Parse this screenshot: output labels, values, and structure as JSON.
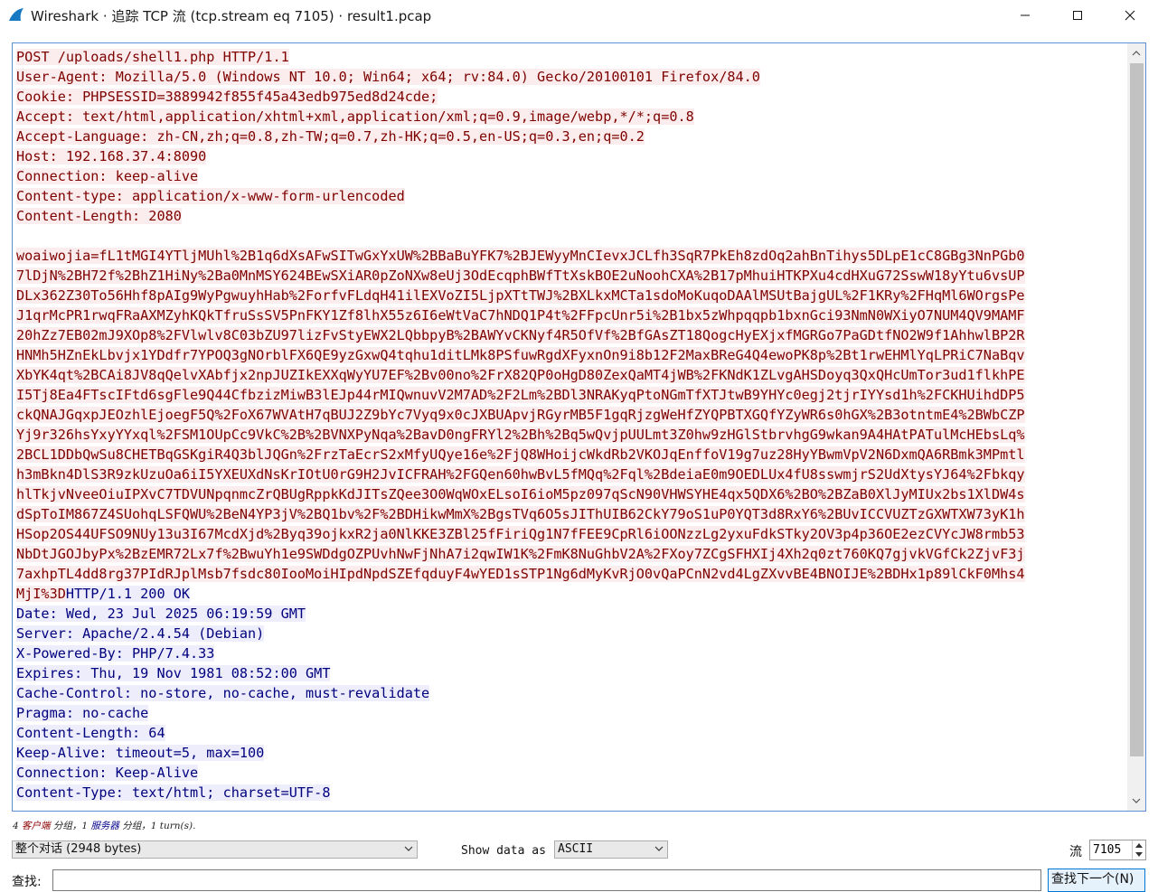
{
  "window": {
    "title": "Wireshark · 追踪 TCP 流 (tcp.stream eq 7105) · result1.pcap"
  },
  "stream": {
    "client_header_lines": [
      "POST /uploads/shell1.php HTTP/1.1",
      "User-Agent: Mozilla/5.0 (Windows NT 10.0; Win64; x64; rv:84.0) Gecko/20100101 Firefox/84.0",
      "Cookie: PHPSESSID=3889942f855f45a43edb975ed8d24cde;",
      "Accept: text/html,application/xhtml+xml,application/xml;q=0.9,image/webp,*/*;q=0.8",
      "Accept-Language: zh-CN,zh;q=0.8,zh-TW;q=0.7,zh-HK;q=0.5,en-US;q=0.3,en;q=0.2",
      "Host: 192.168.37.4:8090",
      "Connection: keep-alive",
      "Content-type: application/x-www-form-urlencoded",
      "Content-Length: 2080"
    ],
    "client_body_lines": [
      "woaiwojia=fL1tMGI4YTljMUhl%2B1q6dXsAFwSITwGxYxUW%2BBaBuYFK7%2BJEWyyMnCIevxJCLfh3SqR7PkEh8zdOq2ahBnTihys5DLpE1cC8GBg3NnPGb0",
      "7lDjN%2BH72f%2BhZ1HiNy%2Ba0MnMSY624BEwSXiAR0pZoNXw8eUj3OdEcqphBWfTtXskBOE2uNoohCXA%2B17pMhuiHTKPXu4cdHXuG72SswW18yYtu6vsUP",
      "DLx362Z30To56Hhf8pAIg9WyPgwuyhHab%2ForfvFLdqH41ilEXVoZI5LjpXTtTWJ%2BXLkxMCTa1sdoMoKuqoDAAlMSUtBajgUL%2F1KRy%2FHqMl6WOrgsPe",
      "J1qrMcPR1rwqFRaAXMZyhKQkTfruSsSV5PnFKY1Zf8lhX55z6I6eWtVaC7hNDQ1P4t%2FFpcUnr5i%2B1bx5zWhpqqpb1bxnGci93NmN0WXiyO7NUM4QV9MAMF",
      "20hZz7EB02mJ9XOp8%2FVlwlv8C03bZU97lizFvStyEWX2LQbbpyB%2BAWYvCKNyf4R5OfVf%2BfGAsZT18QogcHyEXjxfMGRGo7PaGDtfNO2W9f1AhhwlBP2R",
      "HNMh5HZnEkLbvjx1YDdfr7YPOQ3gNOrblFX6QE9yzGxwQ4tqhu1ditLMk8PSfuwRgdXFyxnOn9i8b12F2MaxBReG4Q4ewoPK8p%2Bt1rwEHMlYqLPRiC7NaBqv",
      "XbYK4qt%2BCAi8JV8qQelvXAbfjx2npJUZIkEXXqWyYU7EF%2Bv00no%2FrX82QP0oHgD80ZexQaMT4jWB%2FKNdK1ZLvgAHSDoyq3QxQHcUmTor3ud1flkhPE",
      "I5Tj8Ea4FTscIFtd6sgFle9Q44CfbzizMiwB3lEJp44rMIQwnuvV2M7AD%2F2Lm%2BDl3NRAKyqPtoNGmTfXTJtwB9YHYc0egj2tjrIYYsd1h%2FCKHUihdDP5",
      "ckQNAJGqxpJEOzhlEjoegF5Q%2FoX67WVAtH7qBUJ2Z9bYc7Vyq9x0cJXBUApvjRGyrMB5F1gqRjzgWeHfZYQPBTXGQfYZyWR6s0hGX%2B3otntmE4%2BWbCZP",
      "Yj9r326hsYxyYYxql%2FSM1OUpCc9VkC%2B%2BVNXPyNqa%2BavD0ngFRYl2%2Bh%2Bq5wQvjpUULmt3Z0hw9zHGlStbrvhgG9wkan9A4HAtPATulMcHEbsLq%",
      "2BCL1DDbQwSu8CHETBqGSKgiR4Q3blJQGn%2FrzTaEcrS2xMfyUQye16e%2FjQ8WHoijcWkdRb2VKOJqEnffoV19g7uz28HyYBwmVpV2N6DxmQA6RBmk3MPmtl",
      "h3mBkn4DlS3R9zkUzuOa6iI5YXEUXdNsKrIOtU0rG9H2JvICFRAH%2FGQen60hwBvL5fMQq%2Fql%2BdeiaE0m9OEDLUx4fU8sswmjrS2UdXtysYJ64%2Fbkqy",
      "hlTkjvNveeOiuIPXvC7TDVUNpqnmcZrQBUgRppkKdJITsZQee3O0WqWOxELsoI6ioM5pz097qScN90VHWSYHE4qx5QDX6%2BO%2BZaB0XlJyMIUx2bs1XlDW4s",
      "dSpToIM867Z4SUohqLSFQWU%2BeN4YP3jV%2BQ1bv%2F%2BDHikwMmX%2BgsTVq6O5sJIThUIB62CkY79oS1uP0YQT3d8RxY6%2BUvICCVUZTzGXWTXW73yK1h",
      "HSop2OS44UFSO9NUy13u3I67McdXjd%2Byq39ojkxR2ja0NlKKE3ZBl25fFiriQg1N7fFEE9CpRl6iOONzzLg2yxuFdkSTky2OV3p4p36OE2ezCVYcJW8rmb53",
      "NbDtJGOJbyPx%2BzEMR72Lx7f%2BwuYh1e9SWDdgOZPUvhNwFjNhA7i2qwIW1K%2FmK8NuGhbV2A%2FXoy7ZCgSFHXIj4Xh2q0zt760KQ7gjvkVGfCk2ZjvF3j",
      "7axhpTL4dd8rg37PIdRJplMsb7fsdc80IooMoiHIpdNpdSZEfqduyF4wYED1sSTP1Ng6dMyKvRjO0vQaPCnN2vd4LgZXvvBE4BNOIJE%2BDHx1p89lCkF0Mhs4"
    ],
    "client_body_last": "MjI%3D",
    "server_first": "HTTP/1.1 200 OK",
    "server_lines": [
      "Date: Wed, 23 Jul 2025 06:19:59 GMT",
      "Server: Apache/2.4.54 (Debian)",
      "X-Powered-By: PHP/7.4.33",
      "Expires: Thu, 19 Nov 1981 08:52:00 GMT",
      "Cache-Control: no-store, no-cache, must-revalidate",
      "Pragma: no-cache",
      "Content-Length: 64",
      "Keep-Alive: timeout=5, max=100",
      "Connection: Keep-Alive",
      "Content-Type: text/html; charset=UTF-8"
    ],
    "scroll_position": 0
  },
  "stats": {
    "prefix": "4",
    "client_label": "客户端",
    "mid": "分组，1",
    "server_label": "服务器",
    "suffix": "分组，1 turn(s)."
  },
  "controls": {
    "conversation_select": "整个对话 (2948 bytes)",
    "show_data_label": "Show data as",
    "show_data_value": "ASCII",
    "stream_label": "流",
    "stream_value": "7105"
  },
  "find": {
    "label": "查找:",
    "value": "",
    "next_button": "查找下一个(N)"
  },
  "colors": {
    "client_fg": "#7f0000",
    "client_bg": "#fbeded",
    "server_fg": "#00007f",
    "server_bg": "#ededfb",
    "accent": "#0078d7"
  }
}
